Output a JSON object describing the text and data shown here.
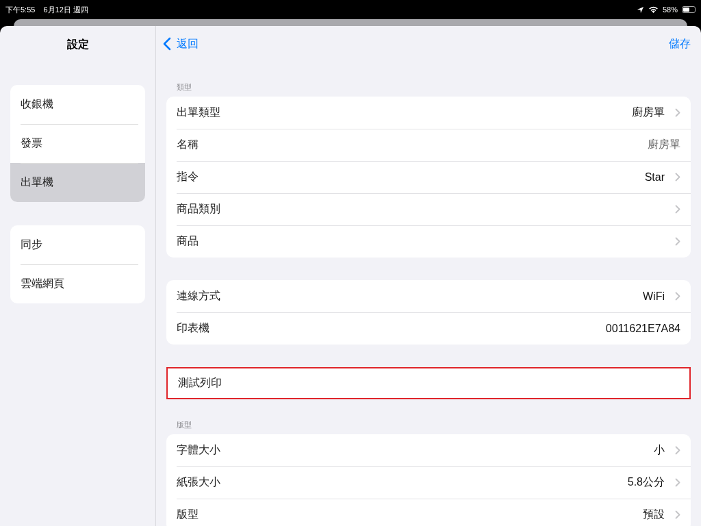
{
  "status_bar": {
    "time": "下午5:55",
    "date": "6月12日 週四",
    "battery": "58%"
  },
  "sidebar": {
    "title": "設定",
    "groups": [
      {
        "items": [
          {
            "label": "收銀機",
            "selected": false
          },
          {
            "label": "發票",
            "selected": false
          },
          {
            "label": "出單機",
            "selected": true
          }
        ]
      },
      {
        "items": [
          {
            "label": "同步",
            "selected": false
          },
          {
            "label": "雲端網頁",
            "selected": false
          }
        ]
      }
    ]
  },
  "nav": {
    "back": "返回",
    "action": "儲存"
  },
  "sections": [
    {
      "header": "類型",
      "highlighted": false,
      "rows": [
        {
          "kind": "nav",
          "label": "出單類型",
          "value": "廚房單"
        },
        {
          "kind": "field",
          "label": "名稱",
          "value": "廚房單"
        },
        {
          "kind": "nav",
          "label": "指令",
          "value": "Star"
        },
        {
          "kind": "nav",
          "label": "商品類別"
        },
        {
          "kind": "nav",
          "label": "商品"
        }
      ]
    },
    {
      "highlighted": false,
      "rows": [
        {
          "kind": "nav",
          "label": "連線方式",
          "value": "WiFi"
        },
        {
          "kind": "info",
          "label": "印表機",
          "value": "0011621E7A84"
        }
      ]
    },
    {
      "highlighted": true,
      "rows": [
        {
          "kind": "action",
          "label": "測試列印"
        }
      ]
    },
    {
      "header": "版型",
      "highlighted": false,
      "rows": [
        {
          "kind": "nav",
          "label": "字體大小",
          "value": "小"
        },
        {
          "kind": "nav",
          "label": "紙張大小",
          "value": "5.8公分"
        },
        {
          "kind": "nav",
          "label": "版型",
          "value": "預設"
        }
      ]
    }
  ]
}
